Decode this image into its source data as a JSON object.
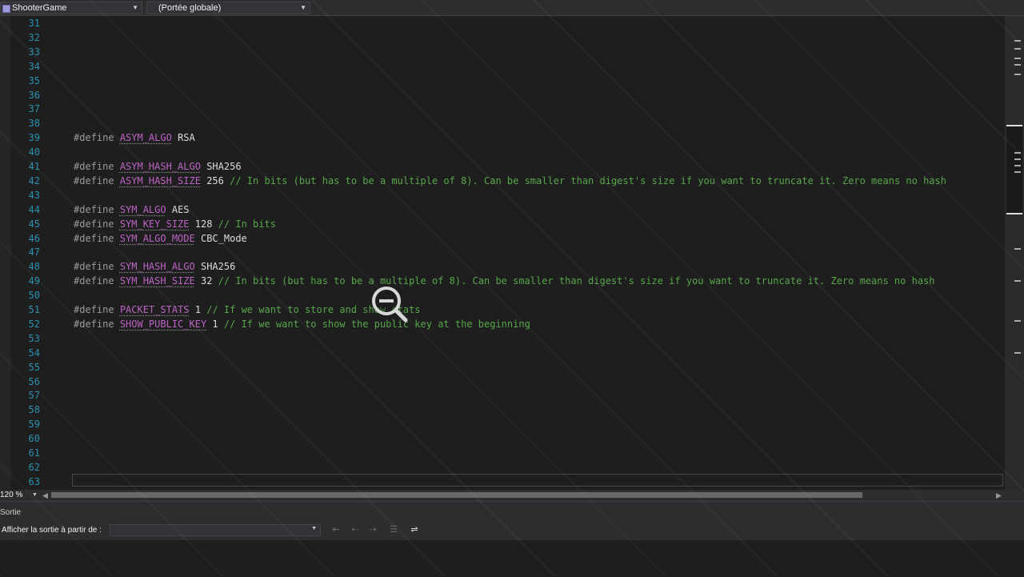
{
  "navbar": {
    "project": "ShooterGame",
    "scope": "(Portée globale)"
  },
  "editor": {
    "lines": [
      {
        "num": "31"
      },
      {
        "num": "32"
      },
      {
        "num": "33"
      },
      {
        "num": "34"
      },
      {
        "num": "35"
      },
      {
        "num": "36"
      },
      {
        "num": "37"
      },
      {
        "num": "38"
      },
      {
        "num": "39",
        "kw": "#define",
        "macro": "ASYM_ALGO",
        "value": "RSA"
      },
      {
        "num": "40"
      },
      {
        "num": "41",
        "kw": "#define",
        "macro": "ASYM_HASH_ALGO",
        "value": "SHA256"
      },
      {
        "num": "42",
        "kw": "#define",
        "macro": "ASYM_HASH_SIZE",
        "value": "256",
        "comment": "// In bits (but has to be a multiple of 8). Can be smaller than digest's size if you want to truncate it. Zero means no hash"
      },
      {
        "num": "43"
      },
      {
        "num": "44",
        "kw": "#define",
        "macro": "SYM_ALGO",
        "value": "AES"
      },
      {
        "num": "45",
        "kw": "#define",
        "macro": "SYM_KEY_SIZE",
        "value": "128",
        "comment": "// In bits"
      },
      {
        "num": "46",
        "kw": "#define",
        "macro": "SYM_ALGO_MODE",
        "value": "CBC_Mode"
      },
      {
        "num": "47"
      },
      {
        "num": "48",
        "kw": "#define",
        "macro": "SYM_HASH_ALGO",
        "value": "SHA256"
      },
      {
        "num": "49",
        "kw": "#define",
        "macro": "SYM_HASH_SIZE",
        "value": "32",
        "comment": "// In bits (but has to be a multiple of 8). Can be smaller than digest's size if you want to truncate it. Zero means no hash"
      },
      {
        "num": "50"
      },
      {
        "num": "51",
        "kw": "#define",
        "macro": "PACKET_STATS",
        "value": "1",
        "comment": "// If we want to store and show stats"
      },
      {
        "num": "52",
        "kw": "#define",
        "macro": "SHOW_PUBLIC_KEY",
        "value": "1",
        "comment": "// If we want to show the public key at the beginning"
      },
      {
        "num": "53"
      },
      {
        "num": "54"
      },
      {
        "num": "55"
      },
      {
        "num": "56"
      },
      {
        "num": "57"
      },
      {
        "num": "58"
      },
      {
        "num": "59"
      },
      {
        "num": "60"
      },
      {
        "num": "61"
      },
      {
        "num": "62"
      },
      {
        "num": "63"
      }
    ]
  },
  "statusbar": {
    "zoom": "120 %"
  },
  "output": {
    "title": "Sortie",
    "show_from_label": "Afficher la sortie à partir de :",
    "source_value": ""
  },
  "colors": {
    "background": "#1e1e1e",
    "line_number": "#2b91af",
    "macro": "#bd63c5",
    "comment": "#57a64a",
    "keyword": "#9b9b9b"
  },
  "icons": {
    "cursor": "zoom-out-magnifier-icon"
  }
}
